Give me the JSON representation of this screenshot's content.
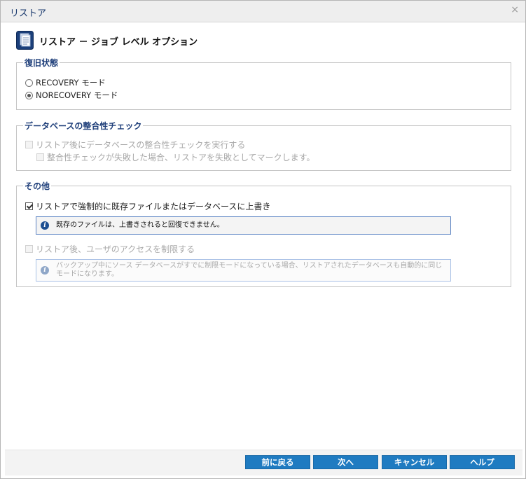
{
  "window": {
    "title": "リストア",
    "close_glyph": "×"
  },
  "header": {
    "title": "リストア － ジョブ レベル オプション",
    "icon": "document-stack-icon"
  },
  "recovery_state": {
    "legend": "復旧状態",
    "options": [
      {
        "label": "RECOVERY モード",
        "selected": false
      },
      {
        "label": "NORECOVERY モード",
        "selected": true
      }
    ]
  },
  "consistency_check": {
    "legend": "データベースの整合性チェック",
    "run_check_label": "リストア後にデータベースの整合性チェックを実行する",
    "mark_failed_label": "整合性チェックが失敗した場合、リストアを失敗としてマークします。"
  },
  "other": {
    "legend": "その他",
    "force_overwrite_label": "リストアで強制的に既存ファイルまたはデータベースに上書き",
    "force_overwrite_info": "既存のファイルは、上書きされると回復できません。",
    "restrict_access_label": "リストア後、ユーザのアクセスを制限する",
    "restrict_access_info": "バックアップ中にソース データベースがすでに制限モードになっている場合、リストアされたデータベースも自動的に同じモードになります。"
  },
  "buttons": {
    "back": "前に戻る",
    "next": "次へ",
    "cancel": "キャンセル",
    "help": "ヘルプ"
  },
  "colors": {
    "button_bg": "#1f7bc1",
    "legend_text": "#1f3f7a",
    "info_border": "#5b83c3"
  }
}
